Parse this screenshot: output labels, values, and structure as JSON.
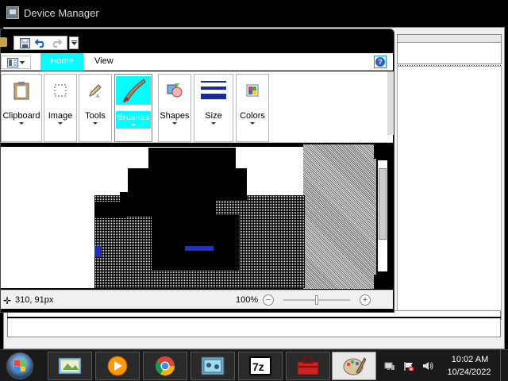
{
  "background_window": {
    "title": "Device Manager"
  },
  "paint": {
    "tabs": [
      {
        "label": "Home",
        "active": true
      },
      {
        "label": "View",
        "active": false
      }
    ],
    "groups": {
      "clipboard": "Clipboard",
      "image": "Image",
      "tools": "Tools",
      "brushes": "Brushes",
      "shapes": "Shapes",
      "size": "Size",
      "colors": "Colors"
    },
    "status": {
      "position": "310, 91px",
      "zoom": "100%"
    },
    "zoom_level": 100
  },
  "taskbar": {
    "clock_time": "10:02 AM",
    "clock_date": "10/24/2022",
    "apps": [
      {
        "name": "paint-taskbar-icon",
        "active": false
      },
      {
        "name": "media-player-taskbar-icon",
        "active": false
      },
      {
        "name": "chrome-taskbar-icon",
        "active": false
      },
      {
        "name": "device-manager-taskbar-icon",
        "active": false
      },
      {
        "name": "7zip-taskbar-icon",
        "active": false
      },
      {
        "name": "toolbox-taskbar-icon",
        "active": false
      },
      {
        "name": "paint-palette-taskbar-icon",
        "active": true
      }
    ]
  },
  "colors": {
    "accent_highlight": "#00ffff",
    "help_blue": "#2560d8"
  }
}
